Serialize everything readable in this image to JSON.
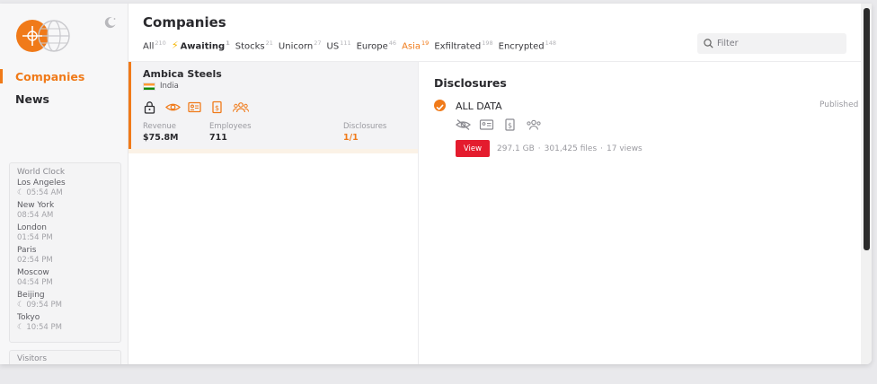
{
  "sidebar": {
    "nav": [
      {
        "label": "Companies",
        "active": true
      },
      {
        "label": "News",
        "active": false
      }
    ],
    "world_clock": {
      "title": "World Clock",
      "cities": [
        {
          "city": "Los Angeles",
          "time": "☾ 05:54 AM"
        },
        {
          "city": "New York",
          "time": "08:54 AM"
        },
        {
          "city": "London",
          "time": "01:54 PM"
        },
        {
          "city": "Paris",
          "time": "02:54 PM"
        },
        {
          "city": "Moscow",
          "time": "04:54 PM"
        },
        {
          "city": "Beijing",
          "time": "☾ 09:54 PM"
        },
        {
          "city": "Tokyo",
          "time": "☾ 10:54 PM"
        }
      ]
    },
    "visitors": {
      "title": "Visitors"
    }
  },
  "header": {
    "title": "Companies",
    "tabs": [
      {
        "label": "All",
        "count": "210"
      },
      {
        "label": "Awaiting",
        "count": "1",
        "icon": "lightning-icon"
      },
      {
        "label": "Stocks",
        "count": "21"
      },
      {
        "label": "Unicorn",
        "count": "27"
      },
      {
        "label": "US",
        "count": "111"
      },
      {
        "label": "Europe",
        "count": "46"
      },
      {
        "label": "Asia",
        "count": "19",
        "active": true
      },
      {
        "label": "Exfiltrated",
        "count": "198"
      },
      {
        "label": "Encrypted",
        "count": "148"
      }
    ],
    "filter_placeholder": "Filter"
  },
  "company": {
    "name": "Ambica Steels",
    "country": "India",
    "icons": [
      "lock-icon",
      "eye-icon",
      "id-card-icon",
      "document-dollar-icon",
      "people-icon"
    ],
    "revenue_label": "Revenue",
    "revenue": "$75.8M",
    "employees_label": "Employees",
    "employees": "711",
    "disclosures_label": "Disclosures",
    "disclosures": "1/1"
  },
  "disclosures": {
    "title": "Disclosures",
    "item": {
      "name": "ALL DATA",
      "status": "Published",
      "icons": [
        "eye-icon",
        "id-card-icon",
        "document-dollar-icon",
        "people-icon"
      ],
      "view_label": "View",
      "size": "297.1 GB",
      "files": "301,425 files",
      "views": "17 views"
    }
  },
  "colors": {
    "accent": "#f07a19",
    "view_button": "#e41c2e"
  }
}
